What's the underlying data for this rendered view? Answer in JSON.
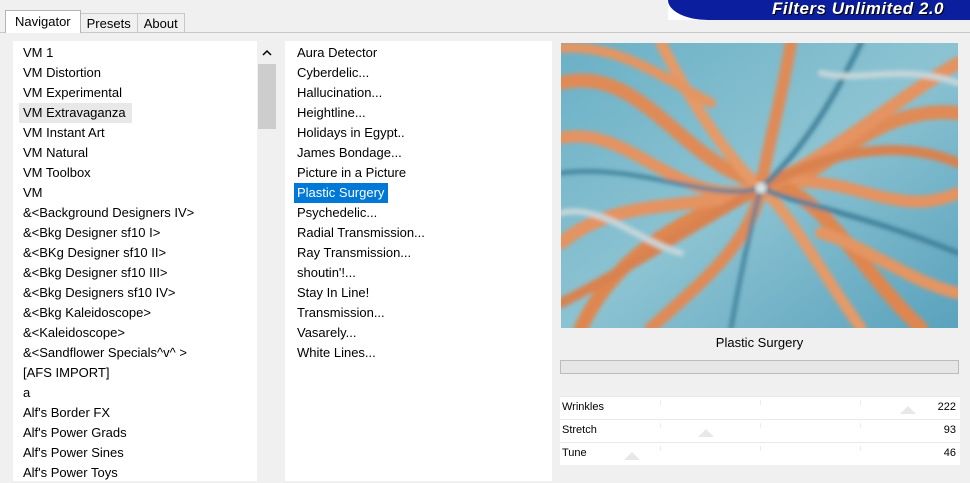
{
  "tabs": [
    "Navigator",
    "Presets",
    "About"
  ],
  "banner_title": "Filters Unlimited 2.0",
  "categories": [
    "VM 1",
    "VM Distortion",
    "VM Experimental",
    "VM Extravaganza",
    "VM Instant Art",
    "VM Natural",
    "VM Toolbox",
    "VM",
    "&<Background Designers IV>",
    "&<Bkg Designer sf10 I>",
    "&<BKg Designer sf10 II>",
    "&<Bkg Designer sf10 III>",
    "&<Bkg Designers sf10 IV>",
    "&<Bkg Kaleidoscope>",
    "&<Kaleidoscope>",
    "&<Sandflower Specials^v^ >",
    "[AFS IMPORT]",
    "a",
    "Alf's Border FX",
    "Alf's Power Grads",
    "Alf's Power Sines",
    "Alf's Power Toys"
  ],
  "selected_category_index": 3,
  "filters": [
    "Aura Detector",
    "Cyberdelic...",
    "Hallucination...",
    "Heightline...",
    "Holidays in Egypt..",
    "James Bondage...",
    "Picture in a Picture",
    "Plastic Surgery",
    "Psychedelic...",
    "Radial Transmission...",
    "Ray Transmission...",
    "shoutin'!...",
    "Stay In Line!",
    "Transmission...",
    "Vasarely...",
    "White Lines..."
  ],
  "selected_filter_index": 7,
  "preview_caption": "Plastic Surgery",
  "progress": 0,
  "sliders": [
    {
      "label": "Wrinkles",
      "value": 222,
      "max": 255
    },
    {
      "label": "Stretch",
      "value": 93,
      "max": 255
    },
    {
      "label": "Tune",
      "value": 46,
      "max": 255
    }
  ],
  "colors": {
    "banner_bg": "#0a1e9e",
    "selection_blue": "#0078d7",
    "preview_orange": "#e0895a",
    "preview_teal": "#5aa8c2"
  },
  "icons": {
    "scroll_up": "chevron-up-icon"
  }
}
